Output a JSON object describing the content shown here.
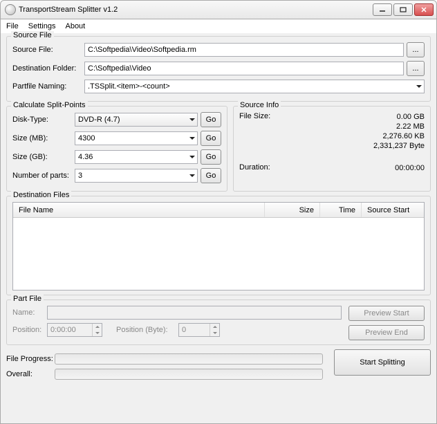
{
  "window": {
    "title": "TransportStream Splitter v1.2"
  },
  "menu": {
    "file": "File",
    "settings": "Settings",
    "about": "About"
  },
  "sourceFile": {
    "legend": "Source File",
    "sourceLabel": "Source File:",
    "sourceValue": "C:\\Softpedia\\Video\\Softpedia.rm",
    "destLabel": "Destination Folder:",
    "destValue": "C:\\Softpedia\\Video",
    "partfileLabel": "Partfile Naming:",
    "partfileValue": ".TSSplit.<item>-<count>"
  },
  "calc": {
    "legend": "Calculate Split-Points",
    "diskTypeLabel": "Disk-Type:",
    "diskTypeValue": "DVD-R (4.7)",
    "sizeMbLabel": "Size (MB):",
    "sizeMbValue": "4300",
    "sizeGbLabel": "Size (GB):",
    "sizeGbValue": "4.36",
    "numPartsLabel": "Number of parts:",
    "numPartsValue": "3",
    "go": "Go"
  },
  "sourceInfo": {
    "legend": "Source Info",
    "fileSizeLabel": "File Size:",
    "gb": "0.00 GB",
    "mb": "2.22 MB",
    "kb": "2,276.60 KB",
    "bytes": "2,331,237 Byte",
    "durationLabel": "Duration:",
    "durationValue": "00:00:00"
  },
  "destFiles": {
    "legend": "Destination Files",
    "colName": "File Name",
    "colSize": "Size",
    "colTime": "Time",
    "colSourceStart": "Source Start"
  },
  "partFile": {
    "legend": "Part File",
    "nameLabel": "Name:",
    "nameValue": "",
    "positionLabel": "Position:",
    "positionValue": "0:00:00",
    "positionByteLabel": "Position (Byte):",
    "positionByteValue": "0",
    "previewStart": "Preview Start",
    "previewEnd": "Preview End"
  },
  "progress": {
    "fileLabel": "File Progress:",
    "overallLabel": "Overall:",
    "startBtn": "Start Splitting"
  }
}
